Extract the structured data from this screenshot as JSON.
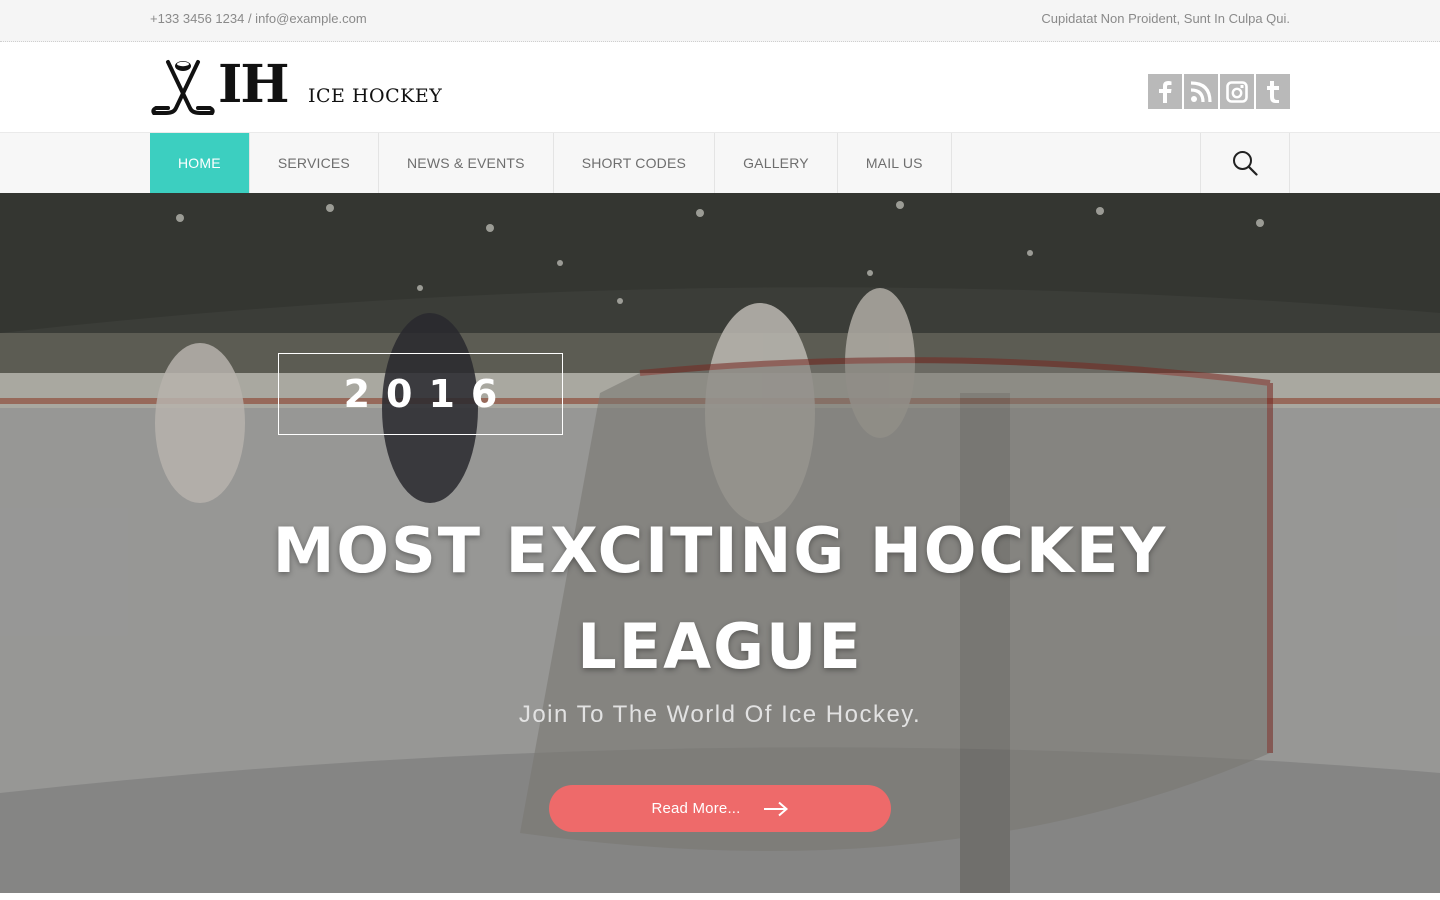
{
  "topbar": {
    "contact": "+133 3456 1234 / info@example.com",
    "tagline": "Cupidatat Non Proident, Sunt In Culpa Qui."
  },
  "brand": {
    "mark": "IH",
    "name": "ICE HOCKEY"
  },
  "social": [
    {
      "icon": "facebook-icon"
    },
    {
      "icon": "rss-icon"
    },
    {
      "icon": "instagram-icon"
    },
    {
      "icon": "tumblr-icon"
    }
  ],
  "nav": {
    "items": [
      {
        "label": "HOME",
        "active": true
      },
      {
        "label": "SERVICES"
      },
      {
        "label": "NEWS & EVENTS"
      },
      {
        "label": "SHORT CODES"
      },
      {
        "label": "GALLERY"
      },
      {
        "label": "MAIL US"
      }
    ],
    "search_icon": "search-icon"
  },
  "hero": {
    "year": "2016",
    "title": "MOST EXCITING HOCKEY LEAGUE",
    "subtitle": "Join To The World Of Ice Hockey.",
    "button_label": "Read More...",
    "button_icon": "arrow-right-icon"
  },
  "colors": {
    "accent": "#3ccfc0",
    "button": "#ee6a6a",
    "social_bg": "#b9b9b9"
  }
}
